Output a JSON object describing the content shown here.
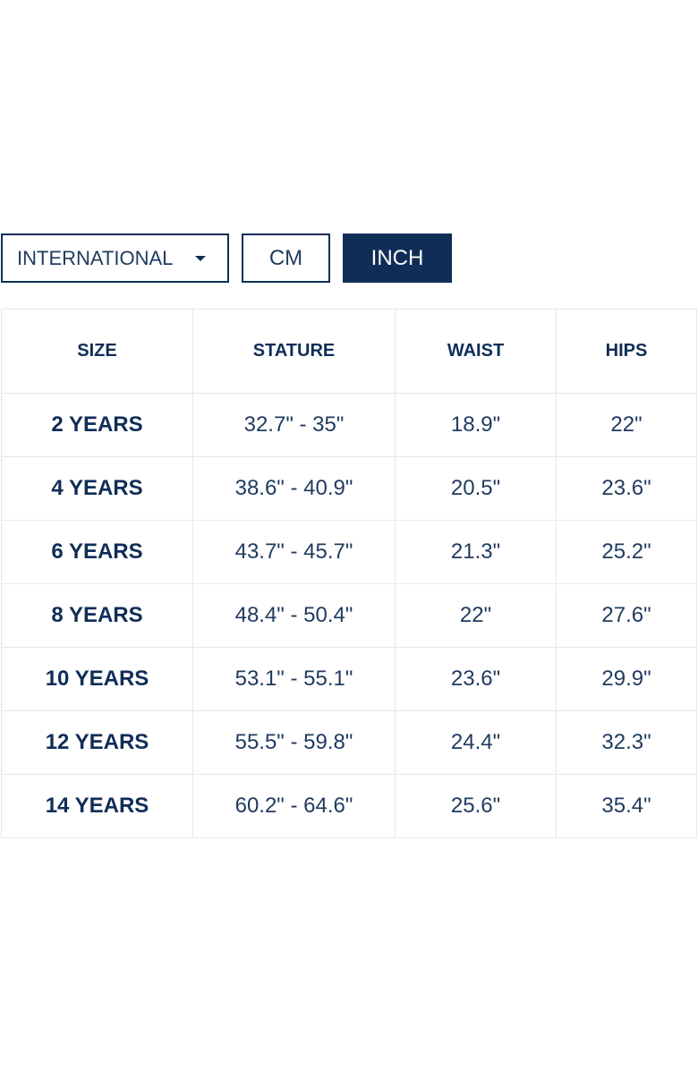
{
  "region_select": {
    "label": "INTERNATIONAL"
  },
  "units": {
    "cm_label": "CM",
    "inch_label": "INCH",
    "selected": "INCH"
  },
  "colors": {
    "accent": "#0f2d57",
    "text": "#1f3a5f",
    "border": "#e4e8ef"
  },
  "table": {
    "headers": [
      "SIZE",
      "STATURE",
      "WAIST",
      "HIPS"
    ],
    "rows": [
      [
        "2 YEARS",
        "32.7\" - 35\"",
        "18.9\"",
        "22\""
      ],
      [
        "4 YEARS",
        "38.6\" - 40.9\"",
        "20.5\"",
        "23.6\""
      ],
      [
        "6 YEARS",
        "43.7\" - 45.7\"",
        "21.3\"",
        "25.2\""
      ],
      [
        "8 YEARS",
        "48.4\" - 50.4\"",
        "22\"",
        "27.6\""
      ],
      [
        "10 YEARS",
        "53.1\" - 55.1\"",
        "23.6\"",
        "29.9\""
      ],
      [
        "12 YEARS",
        "55.5\" - 59.8\"",
        "24.4\"",
        "32.3\""
      ],
      [
        "14 YEARS",
        "60.2\" - 64.6\"",
        "25.6\"",
        "35.4\""
      ]
    ]
  }
}
